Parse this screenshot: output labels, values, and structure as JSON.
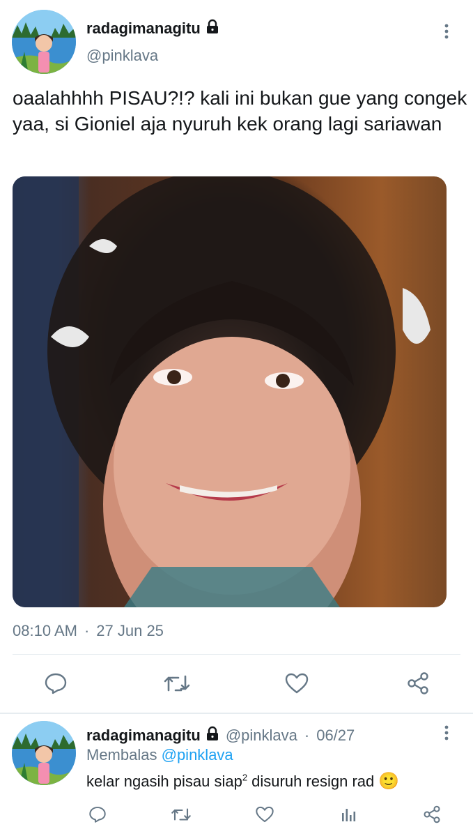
{
  "tweet": {
    "display_name": "radagimanagitu",
    "handle": "@pinklava",
    "text": "oaalahhhh PISAU?!? kali ini bukan gue yang congek yaa, si Gioniel aja nyuruh kek orang lagi sariawan",
    "time": "08:10 AM",
    "separator": "·",
    "date": "27 Jun 25",
    "icons": [
      "reply-icon",
      "retweet-icon",
      "like-icon",
      "share-icon"
    ]
  },
  "reply": {
    "display_name": "radagimanagitu",
    "handle": "@pinklava",
    "separator": "·",
    "date": "06/27",
    "replying_prefix": "Membalas",
    "replying_to": "@pinklava",
    "text_before": "kelar ngasih pisau siap",
    "superscript": "2",
    "text_after": " disuruh resign rad ",
    "emoji": "🙂",
    "icons": [
      "reply-icon",
      "retweet-icon",
      "like-icon",
      "analytics-icon",
      "share-icon"
    ]
  },
  "colors": {
    "text": "#14171a",
    "secondary": "#657786",
    "link": "#1da1f2",
    "divider": "#e6ecf0"
  }
}
